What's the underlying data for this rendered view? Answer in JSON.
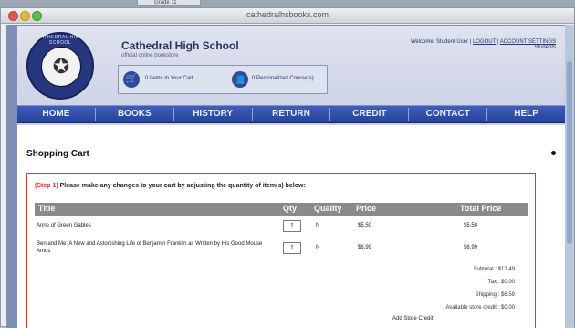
{
  "desktop": {
    "tab_label": "Grade 11"
  },
  "browser": {
    "title": "cathedralhsbooks.com"
  },
  "header": {
    "seal_text": "CATHEDRAL HIGH SCHOOL",
    "school_name": "Cathedral High School",
    "tagline": "official online bookstore",
    "cart_text": "0 Items in Your Cart",
    "courses_text": "0 Personalized Course(s)",
    "welcome": "Welcome, Student User |",
    "logout": "LOGOUT",
    "account_settings": "ACCOUNT SETTINGS",
    "role": "Students"
  },
  "nav": [
    "HOME",
    "BOOKS",
    "HISTORY",
    "RETURN",
    "CREDIT",
    "CONTACT",
    "HELP"
  ],
  "main": {
    "title": "Shopping Cart",
    "step_label": "(Step 1)",
    "step_text": "Please make any changes to your cart by adjusting the quantity of item(s) below:"
  },
  "table": {
    "columns": [
      "Title",
      "Qty",
      "Quality",
      "Price",
      "Total Price"
    ],
    "rows": [
      {
        "title": "Anne of Green Gables",
        "qty": "1",
        "quality": "N",
        "price": "$5.50",
        "total": "$5.50"
      },
      {
        "title": "Ben and Me: A New and Astonishing Life of Benjamin Franklin as Written by His Good Mouse Amos",
        "qty": "1",
        "quality": "N",
        "price": "$6.99",
        "total": "$6.99"
      }
    ]
  },
  "summary": {
    "subtotal": "Subtotal : $12.49",
    "tax": "Tax : $0.00",
    "shipping": "Shipping : $6.59",
    "store_credit": "Available store credit : $0.00",
    "add_credit": "Add Store Credit"
  }
}
